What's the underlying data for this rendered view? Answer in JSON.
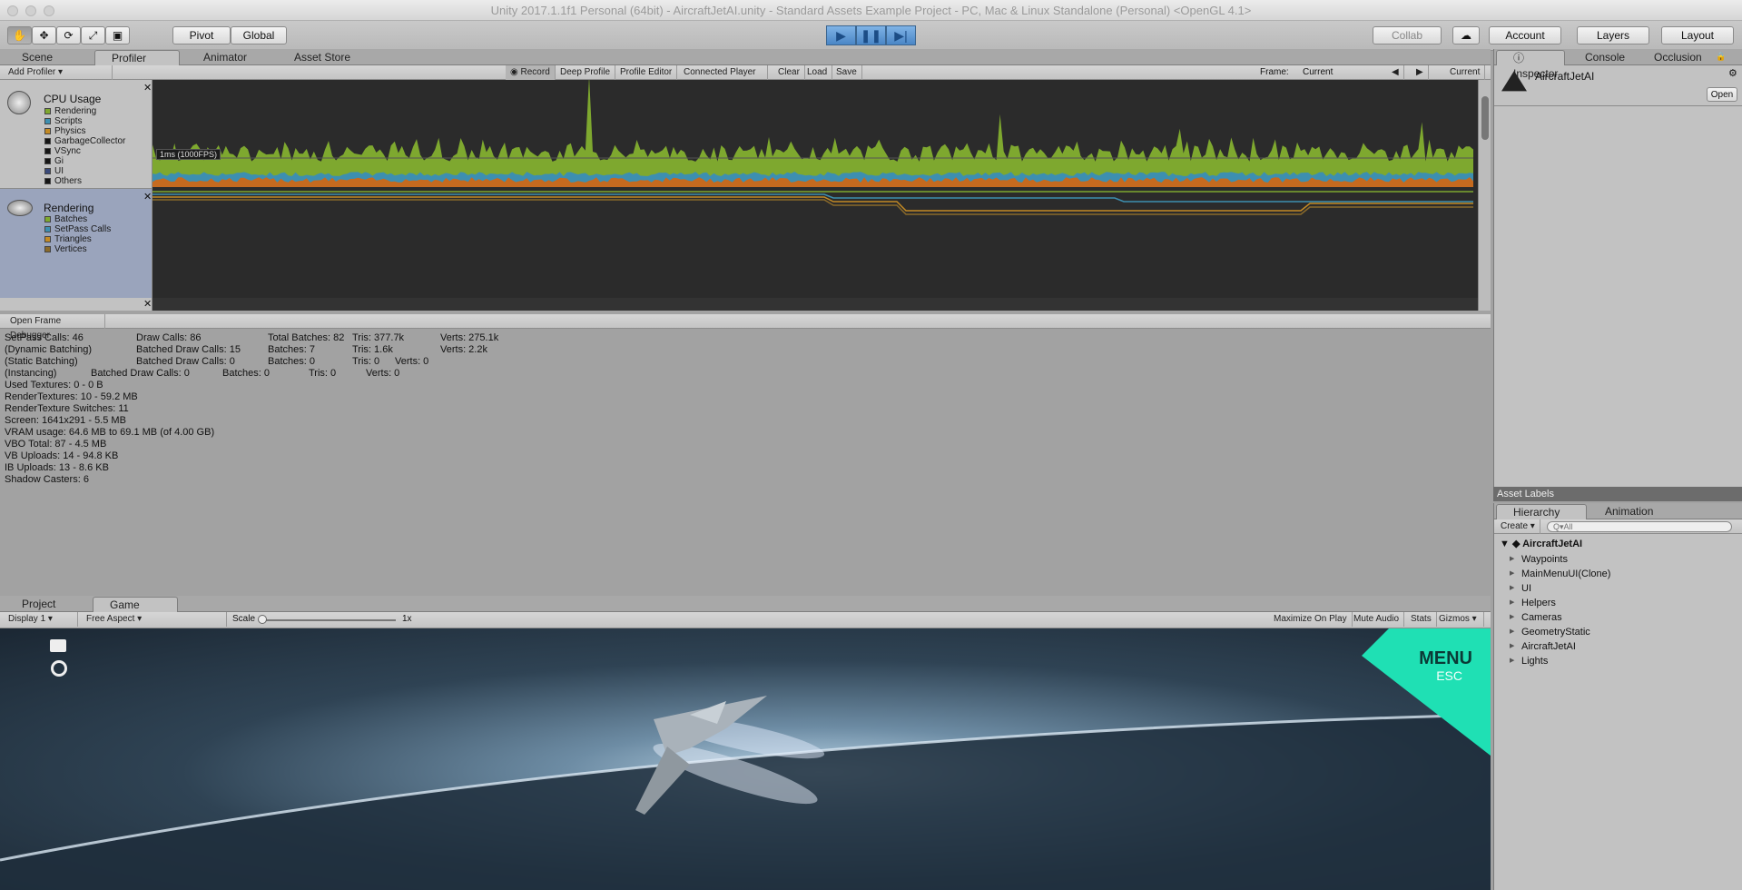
{
  "window": {
    "title": "Unity 2017.1.1f1 Personal (64bit) - AircraftJetAI.unity - Standard Assets Example Project - PC, Mac & Linux Standalone (Personal) <OpenGL 4.1>"
  },
  "toolbar": {
    "pivot": "Pivot",
    "global": "Global",
    "collab": "Collab",
    "account": "Account",
    "layers": "Layers",
    "layout": "Layout"
  },
  "top_tabs": {
    "scene": "Scene",
    "profiler": "Profiler",
    "animator": "Animator",
    "asset_store": "Asset Store"
  },
  "profiler": {
    "add_profiler": "Add Profiler",
    "record": "Record",
    "deep_profile": "Deep Profile",
    "profile_editor": "Profile Editor",
    "connected_player": "Connected Player",
    "clear": "Clear",
    "load": "Load",
    "save": "Save",
    "frame_label": "Frame:",
    "frame_value": "Current",
    "current_btn": "Current",
    "cpu_title": "CPU Usage",
    "cpu_legend": [
      {
        "label": "Rendering",
        "color": "#7ea82f"
      },
      {
        "label": "Scripts",
        "color": "#3d8fb0"
      },
      {
        "label": "Physics",
        "color": "#c38a24"
      },
      {
        "label": "GarbageCollector",
        "color": "#151515"
      },
      {
        "label": "VSync",
        "color": "#151515"
      },
      {
        "label": "Gi",
        "color": "#151515"
      },
      {
        "label": "UI",
        "color": "#3a4a7a"
      },
      {
        "label": "Others",
        "color": "#151515"
      }
    ],
    "rendering_title": "Rendering",
    "rendering_legend": [
      {
        "label": "Batches",
        "color": "#7ea82f"
      },
      {
        "label": "SetPass Calls",
        "color": "#3d8fb0"
      },
      {
        "label": "Triangles",
        "color": "#c38a24"
      },
      {
        "label": "Vertices",
        "color": "#8a6a2a"
      }
    ],
    "ms_label": "1ms (1000FPS)",
    "open_frame_debugger": "Open Frame Debugger",
    "stats": [
      [
        "SetPass Calls: 46",
        "Draw Calls: 86",
        "Total Batches: 82",
        "Tris: 377.7k",
        "Verts: 275.1k"
      ],
      [
        "(Dynamic Batching)",
        "Batched Draw Calls: 15",
        "Batches: 7",
        "Tris: 1.6k",
        "Verts: 2.2k"
      ],
      [
        "(Static Batching)",
        "Batched Draw Calls: 0",
        "Batches: 0",
        "Tris: 0",
        "Verts: 0"
      ],
      [
        "(Instancing)",
        "Batched Draw Calls: 0",
        "Batches: 0",
        "Tris: 0",
        "Verts: 0"
      ]
    ],
    "stats_lines": [
      "Used Textures: 0 - 0 B",
      "RenderTextures: 10 - 59.2 MB",
      "RenderTexture Switches: 11",
      "Screen: 1641x291 - 5.5 MB",
      "VRAM usage: 64.6 MB to 69.1 MB (of 4.00 GB)",
      "VBO Total: 87 - 4.5 MB",
      "VB Uploads: 14 - 94.8 KB",
      "IB Uploads: 13 - 8.6 KB",
      "Shadow Casters: 6"
    ]
  },
  "inspector": {
    "tab_inspector": "Inspector",
    "tab_console": "Console",
    "tab_occlusion": "Occlusion",
    "asset_name": "AircraftJetAI",
    "open": "Open",
    "asset_labels": "Asset Labels"
  },
  "hierarchy": {
    "tab_hierarchy": "Hierarchy",
    "tab_animation": "Animation",
    "create": "Create",
    "search_placeholder": "Q▾All",
    "root": "AircraftJetAI",
    "items": [
      "Waypoints",
      "MainMenuUI(Clone)",
      "UI",
      "Helpers",
      "Cameras",
      "GeometryStatic",
      "AircraftJetAI",
      "Lights"
    ]
  },
  "bottom": {
    "tab_project": "Project",
    "tab_game": "Game",
    "display": "Display 1",
    "aspect": "Free Aspect",
    "scale_label": "Scale",
    "scale_value": "1x",
    "maximize": "Maximize On Play",
    "mute": "Mute Audio",
    "stats": "Stats",
    "gizmos": "Gizmos",
    "menu_title": "MENU",
    "menu_key": "ESC"
  }
}
